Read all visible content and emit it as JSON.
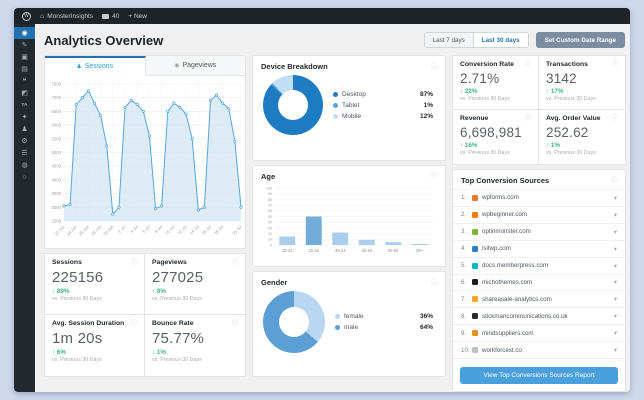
{
  "admin_bar": {
    "wp_label": "W",
    "site_name": "MonsterInsights",
    "comments_count": "40",
    "new_label": "+ New"
  },
  "icons": {
    "info": "ⓘ",
    "chevron_down": "▾",
    "arrow_up": "↑",
    "arrow_down": "↓",
    "home": "⌂"
  },
  "sidebar": {
    "items": [
      {
        "name": "dashboard",
        "glyph": "◉",
        "active": true
      },
      {
        "name": "posts",
        "glyph": "✎",
        "active": false
      },
      {
        "name": "media",
        "glyph": "▣",
        "active": false
      },
      {
        "name": "pages",
        "glyph": "▤",
        "active": false
      },
      {
        "name": "comments",
        "glyph": "❝",
        "active": false
      },
      {
        "name": "appearance",
        "glyph": "◩",
        "active": false
      },
      {
        "name": "ta-plugin",
        "glyph": "TA",
        "active": false
      },
      {
        "name": "plugins",
        "glyph": "✦",
        "active": false
      },
      {
        "name": "users",
        "glyph": "♟",
        "active": false
      },
      {
        "name": "tools",
        "glyph": "⚙",
        "active": false
      },
      {
        "name": "settings",
        "glyph": "☰",
        "active": false
      },
      {
        "name": "monsterinsights",
        "glyph": "◍",
        "active": false
      },
      {
        "name": "collapse",
        "glyph": "○",
        "active": false
      }
    ]
  },
  "header": {
    "title": "Analytics Overview",
    "range_buttons": [
      {
        "label": "Last 7 days",
        "active": false
      },
      {
        "label": "Last 30 days",
        "active": true
      }
    ],
    "custom_range_label": "Set Custom Date Range"
  },
  "tabs": [
    {
      "label": "Sessions",
      "icon": "person-icon",
      "glyph": "♟",
      "active": true
    },
    {
      "label": "Pageviews",
      "icon": "eye-icon",
      "glyph": "◉",
      "active": false
    }
  ],
  "chart_data": [
    {
      "id": "sessions_trend",
      "type": "line",
      "title": "Sessions",
      "ylim": [
        2500,
        7500
      ],
      "ytick_step": 500,
      "values": [
        3050,
        3100,
        6750,
        7000,
        7250,
        6800,
        6350,
        5250,
        2750,
        3000,
        6650,
        6900,
        6750,
        6500,
        5600,
        2950,
        3050,
        6500,
        6800,
        6650,
        6400,
        5500,
        2900,
        3000,
        6900,
        7100,
        6800,
        6600,
        5400,
        3000
      ],
      "tick_indices": [
        0,
        2,
        4,
        6,
        8,
        10,
        12,
        14,
        16,
        18,
        20,
        22,
        24,
        26,
        29
      ],
      "x_labels": [
        "22 Jun",
        "24 Jun",
        "26 Jun",
        "28 Jun",
        "30 Jun",
        "2 Jul",
        "4 Jul",
        "6 Jul",
        "8 Jul",
        "10 Jul",
        "12 Jul",
        "14 Jul",
        "16 Jul",
        "18 Jul",
        "21 Jul"
      ],
      "line_color": "#58a6dd",
      "fill_color": "#cfe4f4",
      "grid": true,
      "legend_position": "none"
    },
    {
      "id": "device_breakdown",
      "type": "pie",
      "title": "Device Breakdown",
      "labels": [
        "Desktop",
        "Tablet",
        "Mobile"
      ],
      "values": [
        87,
        1,
        12
      ],
      "colors": [
        "#1e7dc2",
        "#55a6e3",
        "#c3def4"
      ],
      "legend_position": "right"
    },
    {
      "id": "age",
      "type": "bar",
      "title": "Age",
      "categories": [
        "18-24",
        "25-34",
        "35-44",
        "45-54",
        "55-64",
        "65+"
      ],
      "values": [
        15,
        50,
        22,
        9,
        5,
        2
      ],
      "ylim": [
        0,
        100
      ],
      "ytick_step": 10,
      "colors": [
        "#a9cdeb",
        "#74acd9",
        "#a9cdeb",
        "#a9cdeb",
        "#a9cdeb",
        "#a9cdeb"
      ],
      "grid": true
    },
    {
      "id": "gender",
      "type": "pie",
      "title": "Gender",
      "labels": [
        "female",
        "male"
      ],
      "values": [
        36,
        64
      ],
      "colors": [
        "#b9d7f1",
        "#5b9fd4"
      ],
      "legend_position": "right"
    }
  ],
  "stats_left": [
    {
      "label": "Sessions",
      "value": "225156",
      "change": "89%",
      "direction": "up",
      "compare": "vs. Previous 30 Days"
    },
    {
      "label": "Pageviews",
      "value": "277025",
      "change": "8%",
      "direction": "up",
      "compare": "vs. Previous 30 Days"
    },
    {
      "label": "Avg. Session Duration",
      "value": "1m 20s",
      "change": "6%",
      "direction": "up",
      "compare": "vs. Previous 30 Days"
    },
    {
      "label": "Bounce Rate",
      "value": "75.77%",
      "change": "1%",
      "direction": "down",
      "compare": "vs. Previous 30 Days"
    }
  ],
  "stats_right": [
    {
      "label": "Conversion Rate",
      "value": "2.71%",
      "change": "22%",
      "direction": "up",
      "compare": "vs. Previous 30 Days"
    },
    {
      "label": "Transactions",
      "value": "3142",
      "change": "17%",
      "direction": "up",
      "compare": "vs. Previous 30 Days"
    },
    {
      "label": "Revenue",
      "value": "6,698,981",
      "change": "16%",
      "direction": "up",
      "compare": "vs. Previous 30 Days"
    },
    {
      "label": "Avg. Order Value",
      "value": "252.62",
      "change": "1%",
      "direction": "up",
      "compare": "vs. Previous 30 Days"
    }
  ],
  "top_sources": {
    "title": "Top Conversion Sources",
    "items": [
      {
        "rank": "1.",
        "domain": "wpforms.com",
        "color": "#e27730"
      },
      {
        "rank": "2.",
        "domain": "wpbeginner.com",
        "color": "#ff7700"
      },
      {
        "rank": "3.",
        "domain": "optinmonster.com",
        "color": "#7fb63d"
      },
      {
        "rank": "4.",
        "domain": "isitwp.com",
        "color": "#2e80c6"
      },
      {
        "rank": "5.",
        "domain": "docs.memberpress.com",
        "color": "#06b6c9"
      },
      {
        "rank": "6.",
        "domain": "michothemes.com",
        "color": "#1f1f1f"
      },
      {
        "rank": "7.",
        "domain": "shareasale-analytics.com",
        "color": "#f5a623"
      },
      {
        "rank": "8.",
        "domain": "stickmancommunications.co.uk",
        "color": "#2b2b2b"
      },
      {
        "rank": "9.",
        "domain": "mindsuppliers.com",
        "color": "#f08c1e"
      },
      {
        "rank": "10.",
        "domain": "workforcext.co",
        "color": "#b9c0c7"
      }
    ],
    "button_label": "View Top Conversions Sources Report"
  },
  "colors": {
    "positive_green": "#3db389",
    "accent_blue": "#2271b1",
    "report_button_blue": "#4aa0dc",
    "custom_range_button_gray": "#7b8da0"
  }
}
